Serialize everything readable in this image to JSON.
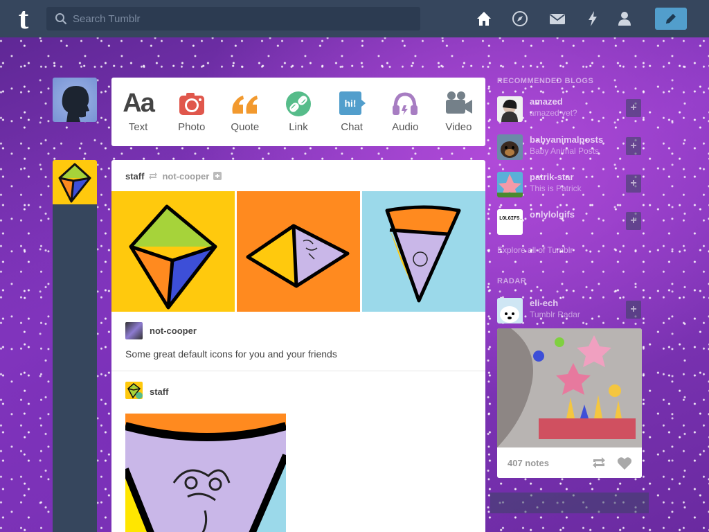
{
  "header": {
    "logo": "t",
    "search_placeholder": "Search Tumblr",
    "nav": [
      "home-icon",
      "explore-icon",
      "inbox-icon",
      "activity-icon",
      "account-icon"
    ],
    "compose": "pencil-icon"
  },
  "post_types": [
    {
      "label": "Text",
      "glyph": "Aa"
    },
    {
      "label": "Photo"
    },
    {
      "label": "Quote"
    },
    {
      "label": "Link"
    },
    {
      "label": "Chat",
      "glyph": "hi!"
    },
    {
      "label": "Audio"
    },
    {
      "label": "Video"
    }
  ],
  "post": {
    "author": "staff",
    "reblogged_from": "not-cooper",
    "trail": [
      {
        "name": "not-cooper",
        "text": "Some great default icons for you and your friends"
      },
      {
        "name": "staff"
      }
    ]
  },
  "sidebar": {
    "recommended_title": "RECOMMENDED BLOGS",
    "recommended": [
      {
        "name": "amazed",
        "subtitle": "amazed yet?"
      },
      {
        "name": "babyanimalposts",
        "subtitle": "Baby Animal Posts"
      },
      {
        "name": "patrik-star",
        "subtitle": "This is Patrick"
      },
      {
        "name": "onlylolgifs",
        "subtitle": "",
        "avatar_text": "LOLGIFS.NET"
      }
    ],
    "follow_label": "+",
    "explore_link": "Explore all of Tumblr",
    "radar_title": "RADAR",
    "radar_blog": {
      "name": "eli-ech",
      "subtitle": "Tumblr Radar"
    },
    "radar_notes": "407 notes"
  },
  "colors": {
    "header_bg": "#36465d",
    "compose_bg": "#529ecc",
    "photo_icon": "#e0574c",
    "quote_icon": "#f2992e",
    "link_icon": "#56bc8a",
    "chat_icon": "#529ecc",
    "audio_icon": "#a77dc2",
    "video_icon": "#748089",
    "kite_yellow": "#ffc90d",
    "kite_orange": "#ff8a1f",
    "kite_blue": "#9bd9ea"
  }
}
